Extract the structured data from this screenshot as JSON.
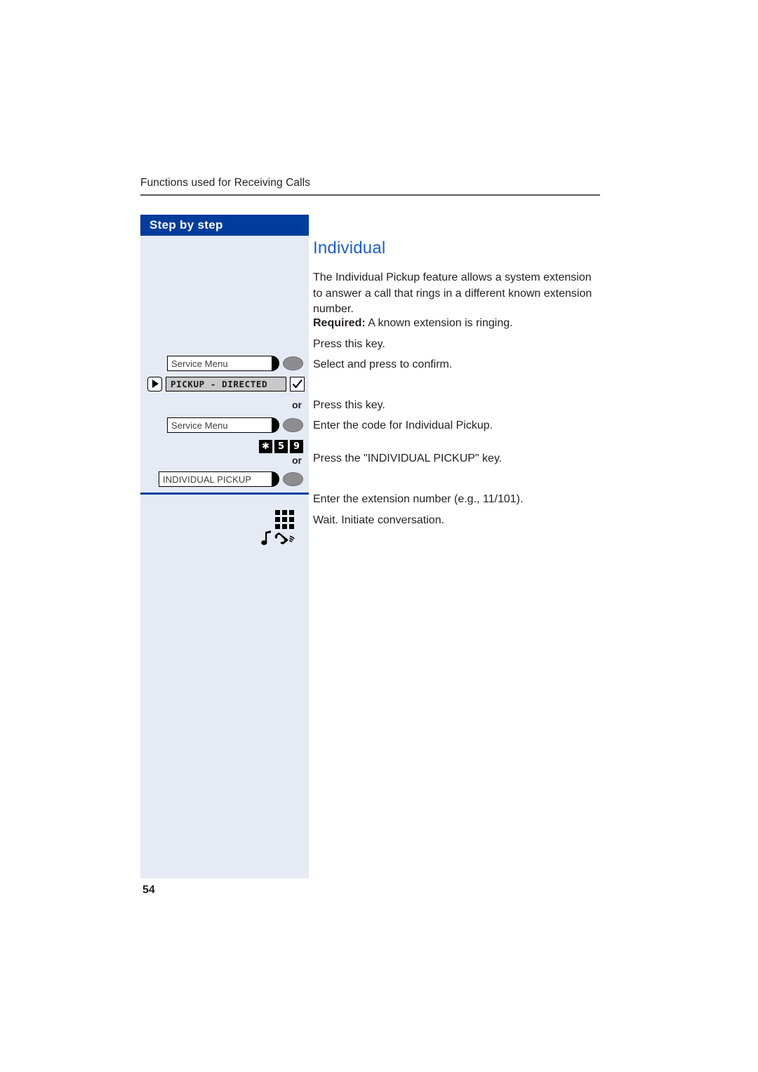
{
  "page": {
    "running_header": "Functions used for Receiving Calls",
    "number": "54"
  },
  "sidebar": {
    "title": "Step by step",
    "rows": [
      {
        "kind": "function-key",
        "label": "Service Menu",
        "icon": "service-menu-key-icon"
      },
      {
        "kind": "display-line",
        "label": "PICKUP - DIRECTED",
        "arrow_icon": "right-arrow-icon",
        "confirm_icon": "checkmark-icon"
      },
      {
        "kind": "separator",
        "label": "or"
      },
      {
        "kind": "function-key",
        "label": "Service Menu",
        "icon": "service-menu-key-icon"
      },
      {
        "kind": "keypad-code",
        "digits": [
          "✱",
          "5",
          "9"
        ],
        "icon": "keypad-digit-icon"
      },
      {
        "kind": "separator",
        "label": "or"
      },
      {
        "kind": "function-key",
        "label": "INDIVIDUAL PICKUP",
        "icon": "individual-pickup-key-icon"
      },
      {
        "kind": "keypad-icon",
        "icon": "keypad-grid-icon"
      },
      {
        "kind": "ring-handset-icon",
        "icon": "ringing-handset-icon"
      }
    ]
  },
  "content": {
    "heading": "Individual",
    "intro": "The Individual Pickup feature allows a system extension to answer a call that rings in a different known extension number.",
    "required_label": "Required:",
    "required_text": " A known extension is ringing.",
    "steps": [
      "Press this key.",
      "Select and press to confirm.",
      "Press this key.",
      "Enter the code for Individual Pickup.",
      "Press the \"INDIVIDUAL PICKUP\" key.",
      "Enter the extension number (e.g., 11/101).",
      "Wait. Initiate conversation."
    ]
  },
  "colors": {
    "brand_blue": "#003c9b",
    "heading_blue": "#1f5fc4",
    "sidebar_bg": "#e5eaf4",
    "rule_blue": "#00429b"
  }
}
